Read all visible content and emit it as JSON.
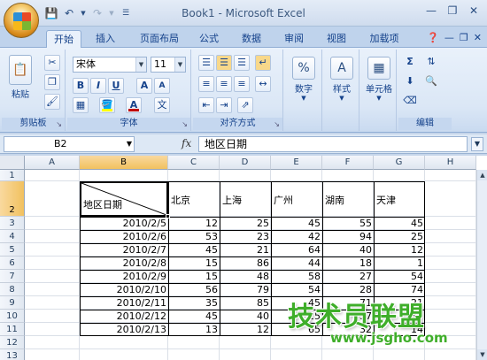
{
  "window": {
    "title": "Book1 - Microsoft Excel"
  },
  "quick_access": {
    "icons": [
      "save-icon",
      "undo-icon",
      "redo-icon",
      "customize-icon"
    ]
  },
  "tabs": [
    {
      "label": "开始",
      "active": true
    },
    {
      "label": "插入"
    },
    {
      "label": "页面布局"
    },
    {
      "label": "公式"
    },
    {
      "label": "数据"
    },
    {
      "label": "审阅"
    },
    {
      "label": "视图"
    },
    {
      "label": "加载项"
    }
  ],
  "ribbon": {
    "clipboard": {
      "paste_label": "粘贴",
      "group_label": "剪贴板"
    },
    "font": {
      "font_name": "宋体",
      "font_size": "11",
      "group_label": "字体",
      "bold": "B",
      "italic": "I",
      "underline": "U",
      "grow": "A",
      "shrink": "A",
      "fill_color": "#ffff00",
      "font_color": "#c00000",
      "phonetic": "文"
    },
    "alignment": {
      "group_label": "对齐方式"
    },
    "number": {
      "button_label": "数字",
      "symbol": "%"
    },
    "styles": {
      "button_label": "样式"
    },
    "cells": {
      "button_label": "单元格"
    },
    "editing": {
      "group_label": "编辑",
      "sum_symbol": "Σ"
    }
  },
  "formula_bar": {
    "name_box": "B2",
    "fx": "fx",
    "content": "地区日期"
  },
  "sheet": {
    "columns": [
      "A",
      "B",
      "C",
      "D",
      "E",
      "F",
      "G",
      "H"
    ],
    "rows": [
      "1",
      "2",
      "3",
      "4",
      "5",
      "6",
      "7",
      "8",
      "9",
      "10",
      "11",
      "12",
      "13"
    ],
    "selected_column": "B",
    "selected_row": "2",
    "header_cell": "地区日期",
    "regions": [
      "北京",
      "上海",
      "广州",
      "湖南",
      "天津"
    ],
    "data": [
      {
        "date": "2010/2/5",
        "values": [
          "12",
          "25",
          "45",
          "55",
          "45"
        ]
      },
      {
        "date": "2010/2/6",
        "values": [
          "53",
          "23",
          "42",
          "94",
          "25"
        ]
      },
      {
        "date": "2010/2/7",
        "values": [
          "45",
          "21",
          "64",
          "40",
          "12"
        ]
      },
      {
        "date": "2010/2/8",
        "values": [
          "15",
          "86",
          "44",
          "18",
          "1"
        ]
      },
      {
        "date": "2010/2/9",
        "values": [
          "15",
          "48",
          "58",
          "27",
          "54"
        ]
      },
      {
        "date": "2010/2/10",
        "values": [
          "56",
          "79",
          "54",
          "28",
          "74"
        ]
      },
      {
        "date": "2010/2/11",
        "values": [
          "35",
          "85",
          "45",
          "71",
          "21"
        ]
      },
      {
        "date": "2010/2/12",
        "values": [
          "45",
          "40",
          "25",
          "57",
          "39"
        ]
      },
      {
        "date": "2010/2/13",
        "values": [
          "13",
          "12",
          "65",
          "32",
          "14"
        ]
      }
    ]
  },
  "watermark": {
    "main": "技术员联盟",
    "url": "www.jsgho.com"
  }
}
